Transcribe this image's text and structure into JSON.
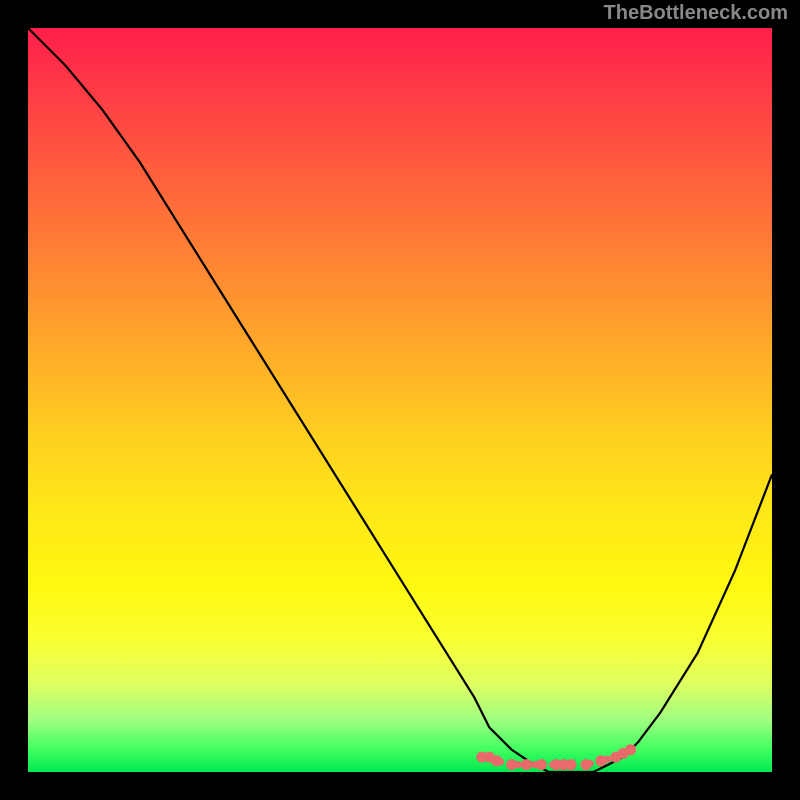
{
  "watermark": "TheBottleneck.com",
  "chart_data": {
    "type": "line",
    "title": "",
    "xlabel": "",
    "ylabel": "",
    "xlim": [
      0,
      100
    ],
    "ylim": [
      0,
      100
    ],
    "x": [
      0,
      5,
      10,
      15,
      20,
      25,
      30,
      35,
      40,
      45,
      50,
      55,
      60,
      62,
      65,
      68,
      70,
      72,
      74,
      76,
      78,
      80,
      82,
      85,
      90,
      95,
      100
    ],
    "values": [
      100,
      95,
      89,
      82,
      74,
      66,
      58,
      50,
      42,
      34,
      26,
      18,
      10,
      6,
      3,
      1,
      0,
      0,
      0,
      0,
      1,
      2,
      4,
      8,
      16,
      27,
      40
    ],
    "optimal_range_x": [
      62,
      80
    ],
    "markers": {
      "x": [
        61,
        62,
        63,
        65,
        67,
        69,
        71,
        72,
        73,
        75,
        77,
        79,
        80,
        81
      ],
      "y": [
        2,
        2,
        1.5,
        1,
        1,
        1,
        1,
        1,
        1,
        1,
        1.5,
        2,
        2.5,
        3
      ]
    },
    "gradient_stops": [
      {
        "pos": 0,
        "color": "#ff1e4a"
      },
      {
        "pos": 50,
        "color": "#ffd020"
      },
      {
        "pos": 85,
        "color": "#faff30"
      },
      {
        "pos": 100,
        "color": "#00e850"
      }
    ]
  }
}
